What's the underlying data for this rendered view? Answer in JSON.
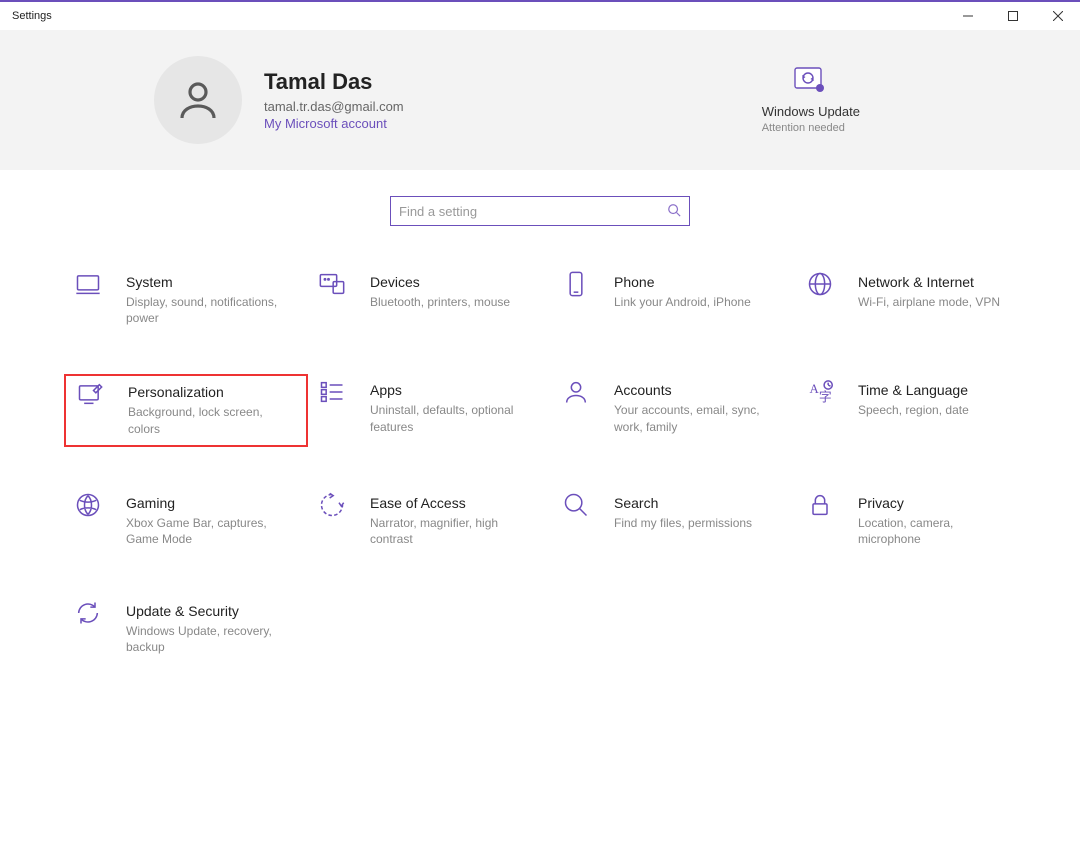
{
  "window_title": "Settings",
  "account": {
    "name": "Tamal Das",
    "email": "tamal.tr.das@gmail.com",
    "ms_link": "My Microsoft account"
  },
  "update": {
    "title": "Windows Update",
    "subtitle": "Attention needed"
  },
  "search": {
    "placeholder": "Find a setting"
  },
  "tiles": {
    "system": {
      "title": "System",
      "sub": "Display, sound, notifications, power"
    },
    "devices": {
      "title": "Devices",
      "sub": "Bluetooth, printers, mouse"
    },
    "phone": {
      "title": "Phone",
      "sub": "Link your Android, iPhone"
    },
    "network": {
      "title": "Network & Internet",
      "sub": "Wi-Fi, airplane mode, VPN"
    },
    "personalization": {
      "title": "Personalization",
      "sub": "Background, lock screen, colors"
    },
    "apps": {
      "title": "Apps",
      "sub": "Uninstall, defaults, optional features"
    },
    "accounts": {
      "title": "Accounts",
      "sub": "Your accounts, email, sync, work, family"
    },
    "time": {
      "title": "Time & Language",
      "sub": "Speech, region, date"
    },
    "gaming": {
      "title": "Gaming",
      "sub": "Xbox Game Bar, captures, Game Mode"
    },
    "ease": {
      "title": "Ease of Access",
      "sub": "Narrator, magnifier, high contrast"
    },
    "search_tile": {
      "title": "Search",
      "sub": "Find my files, permissions"
    },
    "privacy": {
      "title": "Privacy",
      "sub": "Location, camera, microphone"
    },
    "update_sec": {
      "title": "Update & Security",
      "sub": "Windows Update, recovery, backup"
    }
  }
}
